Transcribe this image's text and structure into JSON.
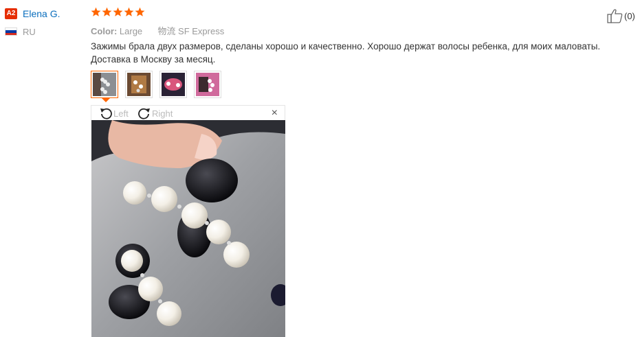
{
  "reviewer": {
    "badge": "A2",
    "name": "Elena G.",
    "country": "RU",
    "flag_colors": [
      "#ffffff",
      "#0039a6",
      "#d52b1e"
    ]
  },
  "rating": {
    "stars": 5,
    "max": 5,
    "color": "#f60"
  },
  "meta": {
    "color_label": "Color:",
    "color_value": "Large",
    "shipping": "物流 SF Express"
  },
  "review_text": "Зажимы брала двух размеров, сделаны хорошо и качественно. Хорошо держат волосы ребенка, для моих маловаты. Доставка в Москву за месяц.",
  "thumbnails": [
    "pearl-clip-photo",
    "brown-clip-photo",
    "pink-clip-photo",
    "pearl-clip-pink-photo"
  ],
  "viewer": {
    "left_label": "Left",
    "right_label": "Right",
    "close": "×"
  },
  "helpful": {
    "count": "(0)"
  },
  "accent_color": "#f60",
  "link_color": "#0a6ebd"
}
